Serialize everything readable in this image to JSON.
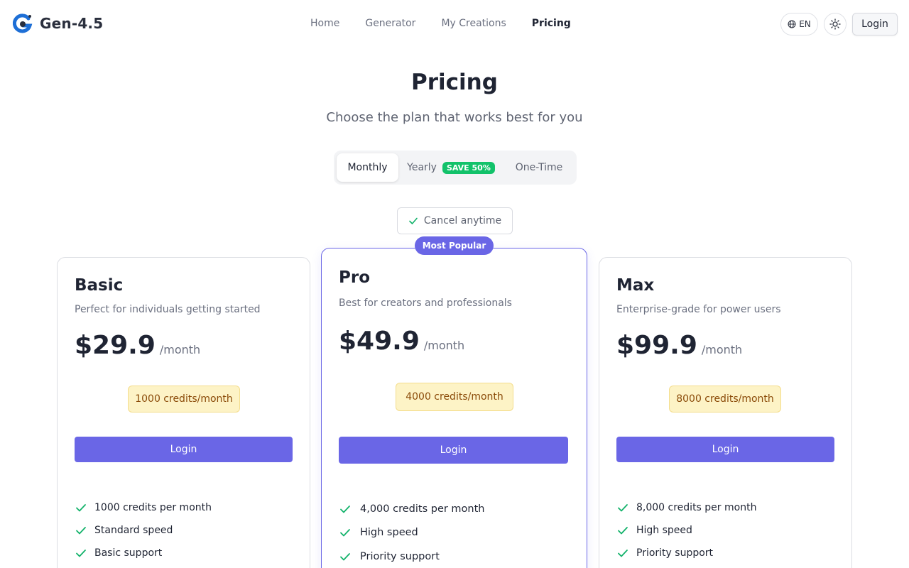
{
  "header": {
    "app_name": "Gen-4.5",
    "nav": [
      "Home",
      "Generator",
      "My Creations",
      "Pricing"
    ],
    "nav_active": "Pricing",
    "language": "EN",
    "login_label": "Login"
  },
  "page": {
    "title": "Pricing",
    "subtitle": "Choose the plan that works best for you"
  },
  "billing": {
    "options": [
      "Monthly",
      "Yearly",
      "One-Time"
    ],
    "selected": "Monthly",
    "yearly_badge": "SAVE 50%"
  },
  "cancel_note": "Cancel anytime",
  "popular_badge": "Most Popular",
  "plans": [
    {
      "name": "Basic",
      "description": "Perfect for individuals getting started",
      "price": "$29.9",
      "period": "/month",
      "credits": "1000 credits/month",
      "cta": "Login",
      "features": [
        "1000 credits per month",
        "Standard speed",
        "Basic support"
      ]
    },
    {
      "name": "Pro",
      "description": "Best for creators and professionals",
      "price": "$49.9",
      "period": "/month",
      "credits": "4000 credits/month",
      "cta": "Login",
      "features": [
        "4,000 credits per month",
        "High speed",
        "Priority support"
      ]
    },
    {
      "name": "Max",
      "description": "Enterprise-grade for power users",
      "price": "$99.9",
      "period": "/month",
      "credits": "8000 credits/month",
      "cta": "Login",
      "features": [
        "8,000 credits per month",
        "High speed",
        "Priority support"
      ]
    }
  ],
  "colors": {
    "accent": "#6a66e6",
    "save_badge": "#12c26a",
    "check": "#12b26a",
    "credits_bg": "#fdf3c6",
    "credits_text": "#8a4a08"
  }
}
